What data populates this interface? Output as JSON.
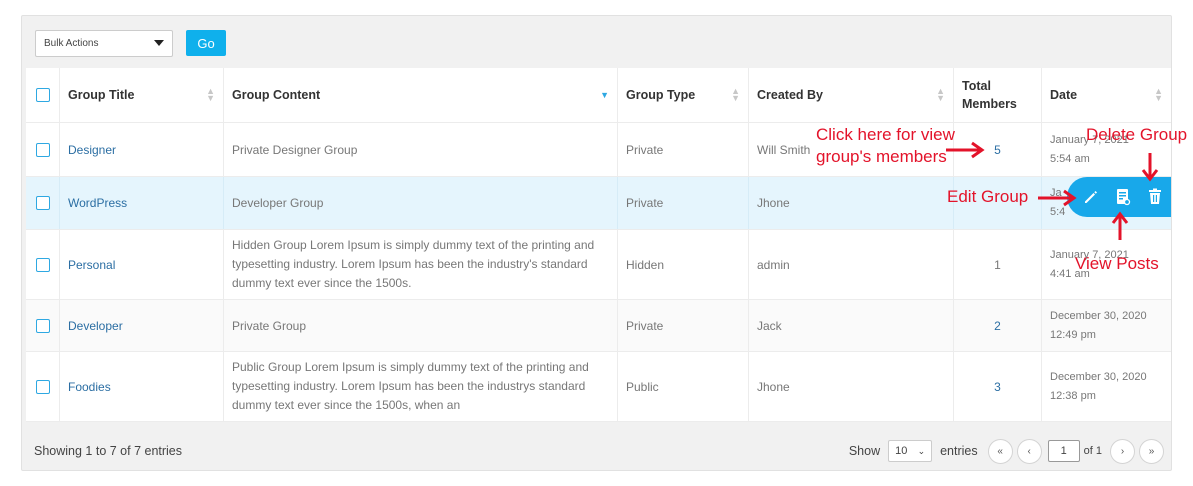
{
  "toolbar": {
    "bulk_actions": "Bulk Actions",
    "go_label": "Go"
  },
  "table": {
    "headers": {
      "title": "Group Title",
      "content": "Group Content",
      "type": "Group Type",
      "created_by": "Created By",
      "total_members_1": "Total",
      "total_members_2": "Members",
      "date": "Date"
    },
    "rows": [
      {
        "title": "Designer",
        "content": "Private Designer Group",
        "type": "Private",
        "created_by": "Will Smith",
        "total": "5",
        "date_1": "January 7, 2021",
        "date_2": "5:54 am"
      },
      {
        "title": "WordPress",
        "content": "Developer Group",
        "type": "Private",
        "created_by": "Jhone",
        "total": "",
        "date_1": "Ja",
        "date_2": "5:4"
      },
      {
        "title": "Personal",
        "content_1": "Hidden Group Lorem Ipsum is simply dummy text of the printing and",
        "content_2": "typesetting industry. Lorem Ipsum has been the industry's standard",
        "content_3": "dummy text ever since the 1500s.",
        "type": "Hidden",
        "created_by": "admin",
        "total": "1",
        "date_1": "January 7, 2021",
        "date_2": "4:41 am"
      },
      {
        "title": "Developer",
        "content": "Private Group",
        "type": "Private",
        "created_by": "Jack",
        "total": "2",
        "date_1": "December 30, 2020",
        "date_2": "12:49 pm"
      },
      {
        "title": "Foodies",
        "content_1": "Public Group Lorem Ipsum is simply dummy text of the printing and",
        "content_2": "typesetting industry. Lorem Ipsum has been the industrys standard",
        "content_3": "dummy text ever since the 1500s, when an",
        "type": "Public",
        "created_by": "Jhone",
        "total": "3",
        "date_1": "December 30, 2020",
        "date_2": "12:38 pm"
      }
    ]
  },
  "footer": {
    "showing": "Showing 1 to 7 of 7 entries",
    "show_label": "Show",
    "per_page": "10",
    "entries_label": "entries",
    "first": "«",
    "prev": "‹",
    "page": "1",
    "of": "of 1",
    "next": "›",
    "last": "»"
  },
  "annotations": {
    "view_members_1": "Click here for view",
    "view_members_2": "group's members",
    "delete_group": "Delete Group",
    "edit_group": "Edit Group",
    "view_posts": "View Posts"
  },
  "colors": {
    "accent": "#18a8ea",
    "annotation": "#e3132a",
    "link": "#2b6ea3",
    "highlight_row": "#e5f5fd"
  },
  "icons": [
    "pencil-icon",
    "document-icon",
    "trash-icon",
    "checkbox-icon",
    "sort-icon",
    "caret-down-icon",
    "arrow-icon"
  ]
}
